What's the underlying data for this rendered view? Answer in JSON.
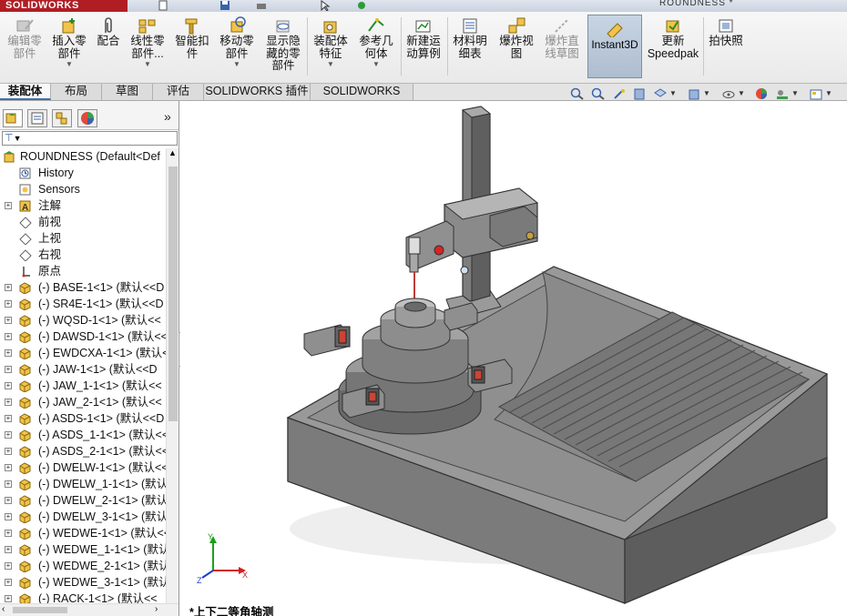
{
  "app": {
    "brand": "SOLIDWORKS",
    "document_title": "ROUNDNESS *"
  },
  "ribbon": {
    "buttons": [
      {
        "id": "edit-component",
        "label": "编辑零\n部件",
        "enabled": false
      },
      {
        "id": "insert-component",
        "label": "插入零\n部件",
        "enabled": true
      },
      {
        "id": "mate",
        "label": "配合",
        "enabled": true
      },
      {
        "id": "linear-pattern",
        "label": "线性零\n部件...",
        "enabled": true
      },
      {
        "id": "smart-fasteners",
        "label": "智能扣\n件",
        "enabled": true
      },
      {
        "id": "move-component",
        "label": "移动零\n部件",
        "enabled": true
      },
      {
        "id": "show-hidden",
        "label": "显示隐\n藏的零\n部件",
        "enabled": true
      },
      {
        "id": "assembly-features",
        "label": "装配体\n特征",
        "enabled": true
      },
      {
        "id": "ref-geometry",
        "label": "参考几\n何体",
        "enabled": true
      },
      {
        "id": "new-motion-study",
        "label": "新建运\n动算例",
        "enabled": true
      },
      {
        "id": "bom",
        "label": "材料明\n细表",
        "enabled": true
      },
      {
        "id": "exploded-view",
        "label": "爆炸视\n图",
        "enabled": true
      },
      {
        "id": "explode-line-sketch",
        "label": "爆炸直\n线草图",
        "enabled": false
      },
      {
        "id": "instant3d",
        "label": "Instant3D",
        "enabled": true
      },
      {
        "id": "update-speedpak",
        "label": "更新\nSpeedpak",
        "enabled": true
      },
      {
        "id": "snapshot",
        "label": "拍快照",
        "enabled": true
      }
    ]
  },
  "tabs": [
    "装配体",
    "布局",
    "草图",
    "评估",
    "SOLIDWORKS 插件",
    "SOLIDWORKS MBD"
  ],
  "active_tab": "装配体",
  "tree": {
    "root": "ROUNDNESS  (Default<Def",
    "items": [
      {
        "label": "History",
        "icon": "history-icon",
        "expandable": false
      },
      {
        "label": "Sensors",
        "icon": "sensor-icon",
        "expandable": false
      },
      {
        "label": "注解",
        "icon": "annotation-icon",
        "expandable": true
      },
      {
        "label": "前视",
        "icon": "plane-icon",
        "expandable": false
      },
      {
        "label": "上视",
        "icon": "plane-icon",
        "expandable": false
      },
      {
        "label": "右视",
        "icon": "plane-icon",
        "expandable": false
      },
      {
        "label": "原点",
        "icon": "origin-icon",
        "expandable": false
      },
      {
        "label": "(-) BASE-1<1> (默认<<D",
        "icon": "part-icon",
        "expandable": true
      },
      {
        "label": "(-) SR4E-1<1> (默认<<D",
        "icon": "part-icon",
        "expandable": true
      },
      {
        "label": "(-) WQSD-1<1> (默认<<",
        "icon": "part-icon",
        "expandable": true
      },
      {
        "label": "(-) DAWSD-1<1> (默认<<",
        "icon": "part-icon",
        "expandable": true
      },
      {
        "label": "(-) EWDCXA-1<1> (默认<",
        "icon": "part-icon",
        "expandable": true
      },
      {
        "label": "(-) JAW-1<1> (默认<<D",
        "icon": "part-icon",
        "expandable": true
      },
      {
        "label": "(-) JAW_1-1<1> (默认<<",
        "icon": "part-icon",
        "expandable": true
      },
      {
        "label": "(-) JAW_2-1<1> (默认<<",
        "icon": "part-icon",
        "expandable": true
      },
      {
        "label": "(-) ASDS-1<1> (默认<<D",
        "icon": "part-icon",
        "expandable": true
      },
      {
        "label": "(-) ASDS_1-1<1> (默认<<",
        "icon": "part-icon",
        "expandable": true
      },
      {
        "label": "(-) ASDS_2-1<1> (默认<<",
        "icon": "part-icon",
        "expandable": true
      },
      {
        "label": "(-) DWELW-1<1> (默认<<",
        "icon": "part-icon",
        "expandable": true
      },
      {
        "label": "(-) DWELW_1-1<1> (默认",
        "icon": "part-icon",
        "expandable": true
      },
      {
        "label": "(-) DWELW_2-1<1> (默认",
        "icon": "part-icon",
        "expandable": true
      },
      {
        "label": "(-) DWELW_3-1<1> (默认",
        "icon": "part-icon",
        "expandable": true
      },
      {
        "label": "(-) WEDWE-1<1> (默认<<",
        "icon": "part-icon",
        "expandable": true
      },
      {
        "label": "(-) WEDWE_1-1<1> (默认",
        "icon": "part-icon",
        "expandable": true
      },
      {
        "label": "(-) WEDWE_2-1<1> (默认",
        "icon": "part-icon",
        "expandable": true
      },
      {
        "label": "(-) WEDWE_3-1<1> (默认",
        "icon": "part-icon",
        "expandable": true
      },
      {
        "label": "(-) RACK-1<1> (默认<<",
        "icon": "part-icon",
        "expandable": true
      }
    ]
  },
  "panel": {
    "collapse_glyph": "»",
    "filter_glyph": "▼"
  },
  "viewport": {
    "view_name": "*上下二等角轴测"
  },
  "colors": {
    "accent": "#b01e24",
    "model_gray": "#8d8d8d",
    "highlight_blue": "#4570a6"
  }
}
